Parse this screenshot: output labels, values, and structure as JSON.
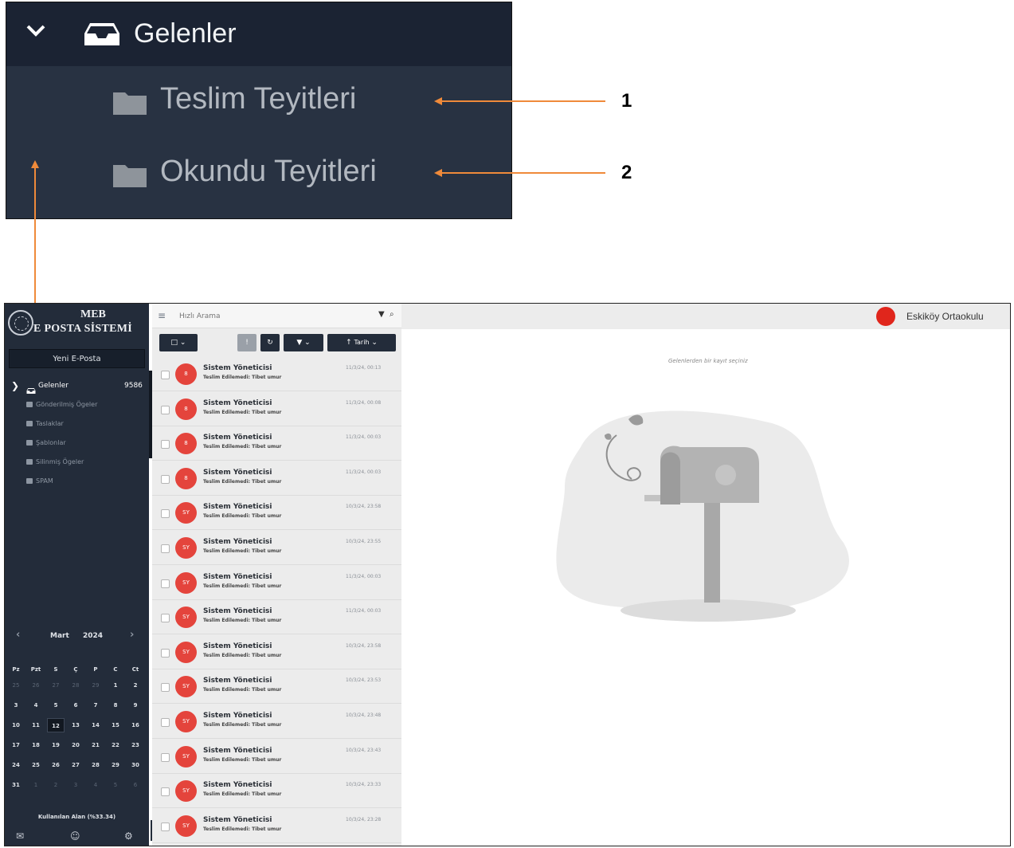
{
  "callout": {
    "header_label": "Gelenler",
    "items": [
      {
        "label": "Teslim Teyitleri",
        "number": "1"
      },
      {
        "label": "Okundu Teyitleri",
        "number": "2"
      }
    ],
    "arrow_color": "#ef8a3a"
  },
  "sidebar": {
    "logo_line1": "MEB",
    "logo_line2": "E POSTA SİSTEMİ",
    "new_mail_button": "Yeni E-Posta",
    "active_folder": {
      "label": "Gelenler",
      "count": "9586"
    },
    "folders": [
      {
        "label": "Gönderilmiş Ögeler",
        "icon": "send-icon"
      },
      {
        "label": "Taslaklar",
        "icon": "drafts-icon"
      },
      {
        "label": "Şablonlar",
        "icon": "templates-icon"
      },
      {
        "label": "Silinmiş Ögeler",
        "icon": "trash-icon"
      },
      {
        "label": "SPAM",
        "icon": "folder-icon"
      }
    ],
    "calendar": {
      "month": "Mart",
      "year": "2024",
      "weekdays": [
        "Pz",
        "Pzt",
        "S",
        "Ç",
        "P",
        "C",
        "Ct"
      ],
      "weeks": [
        [
          "25",
          "26",
          "27",
          "28",
          "29",
          "1",
          "2"
        ],
        [
          "3",
          "4",
          "5",
          "6",
          "7",
          "8",
          "9"
        ],
        [
          "10",
          "11",
          "12",
          "13",
          "14",
          "15",
          "16"
        ],
        [
          "17",
          "18",
          "19",
          "20",
          "21",
          "22",
          "23"
        ],
        [
          "24",
          "25",
          "26",
          "27",
          "28",
          "29",
          "30"
        ],
        [
          "31",
          "1",
          "2",
          "3",
          "4",
          "5",
          "6"
        ]
      ],
      "today": "12"
    },
    "quota_text": "Kullanılan Alan (%33.34)"
  },
  "list": {
    "search_placeholder": "Hızlı Arama",
    "sort_label": "Tarih",
    "messages": [
      {
        "avatar": "8",
        "from": "Sistem Yöneticisi",
        "subject": "Teslim Edilemedi: Tibet umur",
        "date": "11/3/24, 00:13"
      },
      {
        "avatar": "8",
        "from": "Sistem Yöneticisi",
        "subject": "Teslim Edilemedi: Tibet umur",
        "date": "11/3/24, 00:08"
      },
      {
        "avatar": "8",
        "from": "Sistem Yöneticisi",
        "subject": "Teslim Edilemedi: Tibet umur",
        "date": "11/3/24, 00:03"
      },
      {
        "avatar": "8",
        "from": "Sistem Yöneticisi",
        "subject": "Teslim Edilemedi: Tibet umur",
        "date": "11/3/24, 00:03"
      },
      {
        "avatar": "SY",
        "from": "Sistem Yöneticisi",
        "subject": "Teslim Edilemedi: Tibet umur",
        "date": "10/3/24, 23:58"
      },
      {
        "avatar": "SY",
        "from": "Sistem Yöneticisi",
        "subject": "Teslim Edilemedi: Tibet umur",
        "date": "10/3/24, 23:55"
      },
      {
        "avatar": "SY",
        "from": "Sistem Yöneticisi",
        "subject": "Teslim Edilemedi: Tibet umur",
        "date": "11/3/24, 00:03"
      },
      {
        "avatar": "SY",
        "from": "Sistem Yöneticisi",
        "subject": "Teslim Edilemedi: Tibet umur",
        "date": "11/3/24, 00:03"
      },
      {
        "avatar": "SY",
        "from": "Sistem Yöneticisi",
        "subject": "Teslim Edilemedi: Tibet umur",
        "date": "10/3/24, 23:58"
      },
      {
        "avatar": "SY",
        "from": "Sistem Yöneticisi",
        "subject": "Teslim Edilemedi: Tibet umur",
        "date": "10/3/24, 23:53"
      },
      {
        "avatar": "SY",
        "from": "Sistem Yöneticisi",
        "subject": "Teslim Edilemedi: Tibet umur",
        "date": "10/3/24, 23:48"
      },
      {
        "avatar": "SY",
        "from": "Sistem Yöneticisi",
        "subject": "Teslim Edilemedi: Tibet umur",
        "date": "10/3/24, 23:43"
      },
      {
        "avatar": "SY",
        "from": "Sistem Yöneticisi",
        "subject": "Teslim Edilemedi: Tibet umur",
        "date": "10/3/24, 23:33"
      },
      {
        "avatar": "SY",
        "from": "Sistem Yöneticisi",
        "subject": "Teslim Edilemedi: Tibet umur",
        "date": "10/3/24, 23:28"
      }
    ]
  },
  "reader": {
    "user_name": "Eskiköy Ortaokulu",
    "empty_hint": "Gelenlerden bir kayıt seçiniz"
  }
}
